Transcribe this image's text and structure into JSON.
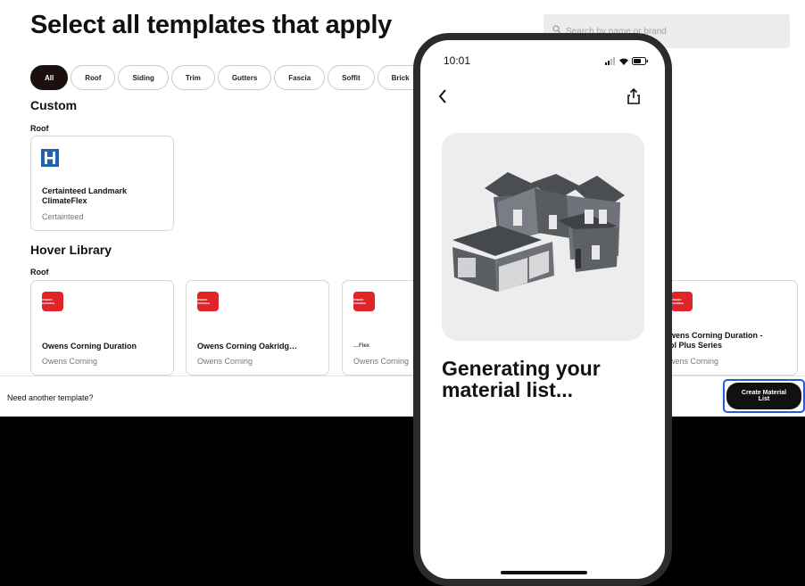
{
  "page": {
    "title": "Select all templates that apply",
    "search_placeholder": "Search by name or brand"
  },
  "filters": [
    "All",
    "Roof",
    "Siding",
    "Trim",
    "Gutters",
    "Fascia",
    "Soffit",
    "Brick"
  ],
  "custom_section": {
    "heading": "Custom",
    "subheading": "Roof",
    "cards": [
      {
        "name": "Certainteed Landmark ClimateFlex",
        "brand": "Certainteed",
        "icon": "certainteed-logo"
      }
    ]
  },
  "library_section": {
    "heading": "Hover Library",
    "subheading": "Roof",
    "cards": [
      {
        "name": "Owens Corning Duration",
        "brand": "Owens Corning",
        "icon": "owens-corning-logo"
      },
      {
        "name": "Owens Corning Oakridg…",
        "brand": "Owens Corning",
        "icon": "owens-corning-logo"
      },
      {
        "name": "…Flex",
        "brand": "Owens Corning",
        "icon": "owens-corning-logo"
      },
      {
        "name": "Owens Corning Duration - Cool Plus Series",
        "name_visible": "wens Corning Duration -\nol Plus Series",
        "brand": "wens Corning",
        "icon": "owens-corning-logo"
      }
    ],
    "logo_text": "OWENS CORNING"
  },
  "footer": {
    "need_text": "Need another template?",
    "cta_label": "Create Material List"
  },
  "phone": {
    "time": "10:01",
    "status_icons": [
      "signal-icon",
      "wifi-icon",
      "battery-icon"
    ],
    "message": "Generating your material list..."
  },
  "colors": {
    "accent_dark": "#1b0f0f",
    "focus_ring": "#2a57d8",
    "brand_red": "#e1242a",
    "certainteed_blue": "#1f63b0"
  }
}
